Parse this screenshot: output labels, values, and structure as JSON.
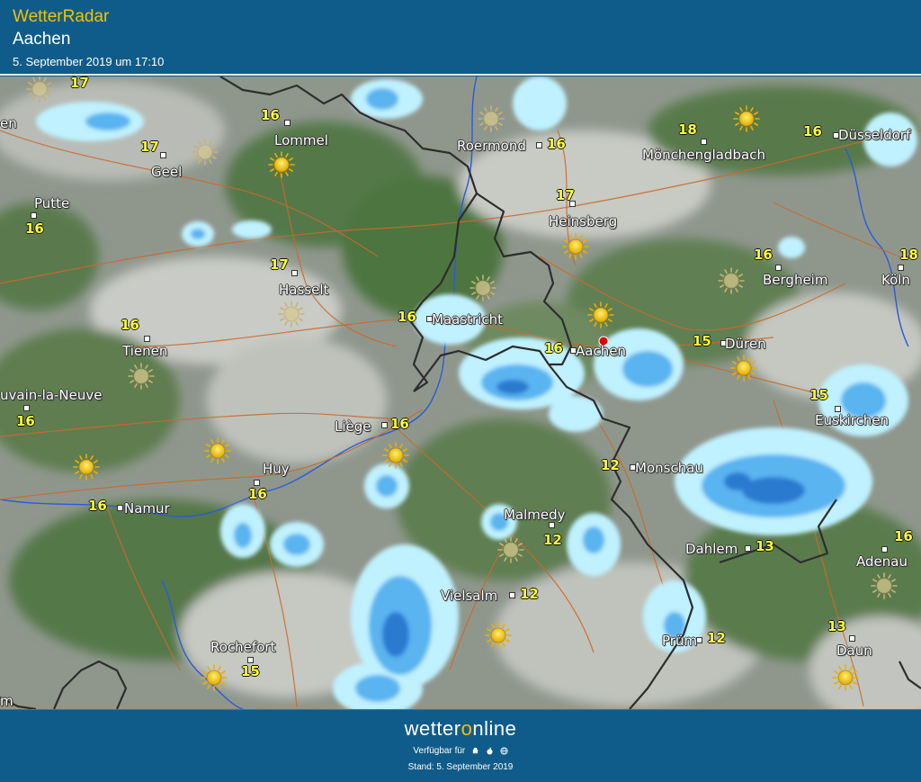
{
  "header": {
    "brand": "WetterRadar",
    "location": "Aachen",
    "datetime": "5. September 2019 um 17:10"
  },
  "colors": {
    "header_bg": "#0f5c8a",
    "brand": "#f2c200",
    "temperature": "#ffff3c",
    "border": "#2d2d2d",
    "road": "#c96a2c",
    "river": "#2a5bd7",
    "rain_light": "#bff1ff",
    "rain_mid": "#5ab4f0",
    "rain_heavy": "#2a7ad0",
    "selected_pin": "#e00000"
  },
  "map": {
    "cities": [
      {
        "id": "lommel",
        "name": "Lommel",
        "temp": "16"
      },
      {
        "id": "geel",
        "name": "Geel",
        "temp": "17"
      },
      {
        "id": "putte",
        "name": "Putte",
        "temp": "16"
      },
      {
        "id": "roermond",
        "name": "Roermond",
        "temp": "16"
      },
      {
        "id": "moenchengladbach",
        "name": "Mönchengladbach",
        "temp": "18"
      },
      {
        "id": "duesseldorf",
        "name": "Düsseldorf",
        "temp": "16"
      },
      {
        "id": "heinsberg",
        "name": "Heinsberg",
        "temp": "17"
      },
      {
        "id": "hasselt",
        "name": "Hasselt",
        "temp": "17"
      },
      {
        "id": "bergheim",
        "name": "Bergheim",
        "temp": "16"
      },
      {
        "id": "koeln",
        "name": "Köln",
        "temp": "18"
      },
      {
        "id": "maastricht",
        "name": "Maastricht",
        "temp": "16"
      },
      {
        "id": "tienen",
        "name": "Tienen",
        "temp": "16"
      },
      {
        "id": "aachen",
        "name": "Aachen",
        "temp": "16"
      },
      {
        "id": "dueren",
        "name": "Düren",
        "temp": "15"
      },
      {
        "id": "louvain",
        "name": "uvain-la-Neuve",
        "temp": "16"
      },
      {
        "id": "euskirchen",
        "name": "Euskirchen",
        "temp": "15"
      },
      {
        "id": "liege",
        "name": "Liège",
        "temp": "16"
      },
      {
        "id": "huy",
        "name": "Huy",
        "temp": "16"
      },
      {
        "id": "monschau",
        "name": "Monschau",
        "temp": "12"
      },
      {
        "id": "namur",
        "name": "Namur",
        "temp": "16"
      },
      {
        "id": "malmedy",
        "name": "Malmedy",
        "temp": "12"
      },
      {
        "id": "dahlem",
        "name": "Dahlem",
        "temp": "13"
      },
      {
        "id": "adenau",
        "name": "Adenau",
        "temp": "16"
      },
      {
        "id": "vielsalm",
        "name": "Vielsalm",
        "temp": "12"
      },
      {
        "id": "pruem",
        "name": "Prüm",
        "temp": "12"
      },
      {
        "id": "rochefort",
        "name": "Rochefort",
        "temp": "15"
      },
      {
        "id": "daun",
        "name": "Daun",
        "temp": "13"
      }
    ],
    "edge_labels": [
      {
        "id": "edge-en",
        "text": "en"
      },
      {
        "id": "edge-m",
        "text": "m"
      }
    ],
    "edge_temps": [
      {
        "id": "edge-temp-17",
        "text": "17"
      }
    ],
    "weather_icons": [
      {
        "id": "sun-1",
        "type": "sunny"
      },
      {
        "id": "sun-2",
        "type": "sunny"
      },
      {
        "id": "sun-3",
        "type": "sunny"
      },
      {
        "id": "sun-4",
        "type": "sunny"
      },
      {
        "id": "sun-5",
        "type": "sunny"
      },
      {
        "id": "sun-6",
        "type": "sunny"
      },
      {
        "id": "sun-7",
        "type": "sunny"
      },
      {
        "id": "sun-8",
        "type": "sunny"
      },
      {
        "id": "sun-9",
        "type": "sunny"
      },
      {
        "id": "sun-10",
        "type": "sunny"
      },
      {
        "id": "sun-11",
        "type": "sunny"
      },
      {
        "id": "haze-1",
        "type": "hazy-sun"
      },
      {
        "id": "haze-2",
        "type": "hazy-sun"
      },
      {
        "id": "haze-3",
        "type": "hazy-sun"
      },
      {
        "id": "haze-4",
        "type": "hazy-sun"
      },
      {
        "id": "haze-5",
        "type": "hazy-sun"
      },
      {
        "id": "haze-6",
        "type": "hazy-sun"
      },
      {
        "id": "haze-7",
        "type": "hazy-sun"
      },
      {
        "id": "haze-8",
        "type": "hazy-sun"
      },
      {
        "id": "haze-9",
        "type": "hazy-sun"
      }
    ],
    "selected_location": "Aachen"
  },
  "footer": {
    "logo_pre": "wetter",
    "logo_o": "o",
    "logo_post": "nline",
    "available_label": "Verfügbar für",
    "platform_icons": [
      "android-icon",
      "apple-icon",
      "web-icon"
    ],
    "stand": "Stand: 5. September 2019"
  }
}
